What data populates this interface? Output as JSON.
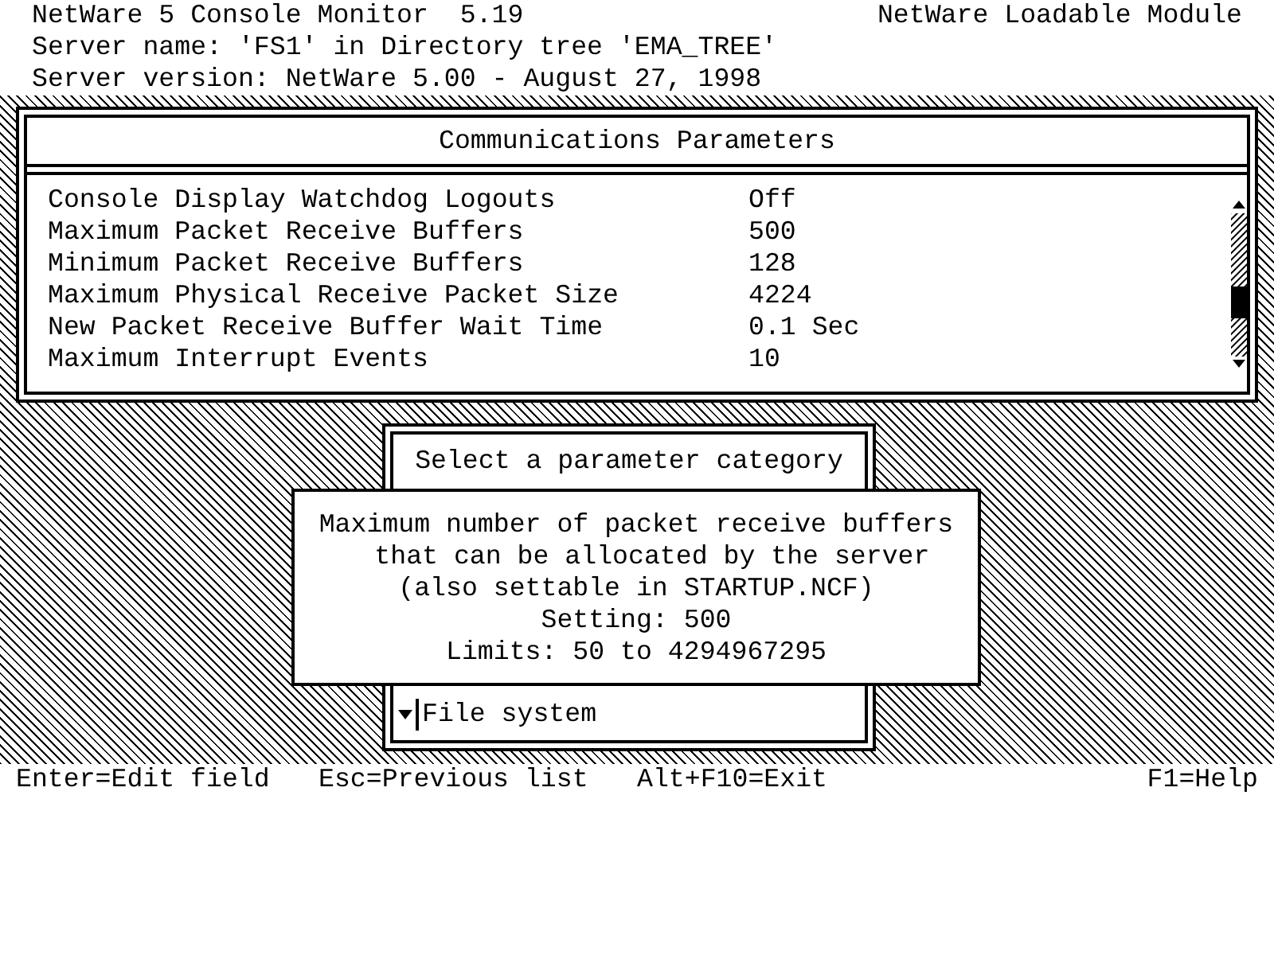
{
  "header": {
    "title": "NetWare 5 Console Monitor  5.19",
    "module": "NetWare Loadable Module",
    "server_name": "Server name: 'FS1' in Directory tree 'EMA_TREE'",
    "server_version": "Server version: NetWare 5.00 - August 27, 1998"
  },
  "parameters_panel": {
    "title": "Communications Parameters",
    "rows": [
      {
        "name": "Console Display Watchdog Logouts",
        "value": "Off"
      },
      {
        "name": "Maximum Packet Receive Buffers",
        "value": "500"
      },
      {
        "name": "Minimum Packet Receive Buffers",
        "value": "128"
      },
      {
        "name": "Maximum Physical Receive Packet Size",
        "value": "4224"
      },
      {
        "name": "New Packet Receive Buffer Wait Time",
        "value": "0.1 Sec"
      },
      {
        "name": "Maximum Interrupt Events",
        "value": "10"
      }
    ]
  },
  "category_panel": {
    "title": "Select a parameter category",
    "items": [
      {
        "label": "File system"
      }
    ]
  },
  "help_box": {
    "description": "Maximum number of packet receive buffers\n  that can be allocated by the server\n(also settable in STARTUP.NCF)",
    "setting": "Setting: 500",
    "limits": "Limits: 50 to 4294967295"
  },
  "footer": [
    "Enter=Edit field",
    "Esc=Previous list",
    "Alt+F10=Exit",
    "F1=Help"
  ]
}
